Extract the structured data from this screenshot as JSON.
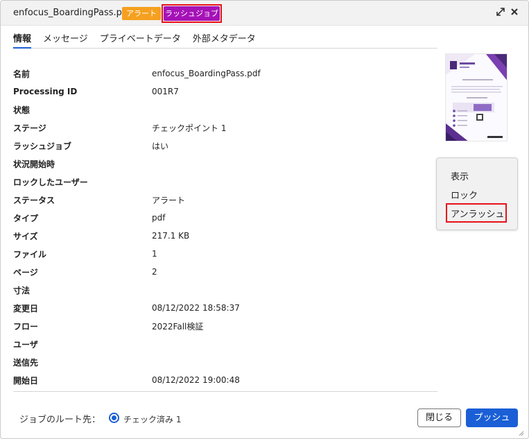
{
  "header": {
    "title": "enfocus_BoardingPass.pdf",
    "badge_alert": "アラート",
    "badge_rush": "ラッシュジョブ",
    "icons": [
      "expand-icon",
      "close-icon"
    ]
  },
  "tabs": [
    {
      "label": "情報",
      "active": true
    },
    {
      "label": "メッセージ",
      "active": false
    },
    {
      "label": "プライベートデータ",
      "active": false
    },
    {
      "label": "外部メタデータ",
      "active": false
    }
  ],
  "properties": [
    {
      "label": "名前",
      "value": "enfocus_BoardingPass.pdf"
    },
    {
      "label": "Processing ID",
      "value": "001R7"
    },
    {
      "label": "状態",
      "value": ""
    },
    {
      "label": "ステージ",
      "value": "チェックポイント 1"
    },
    {
      "label": "ラッシュジョブ",
      "value": "はい"
    },
    {
      "label": "状況開始時",
      "value": ""
    },
    {
      "label": "ロックしたユーザー",
      "value": ""
    },
    {
      "label": "ステータス",
      "value": "アラート"
    },
    {
      "label": "タイプ",
      "value": "pdf"
    },
    {
      "label": "サイズ",
      "value": "217.1 KB"
    },
    {
      "label": "ファイル",
      "value": "1"
    },
    {
      "label": "ページ",
      "value": "2"
    },
    {
      "label": "寸法",
      "value": ""
    },
    {
      "label": "変更日",
      "value": "08/12/2022 18:58:37"
    },
    {
      "label": "フロー",
      "value": "2022Fall検証"
    },
    {
      "label": "ユーザ",
      "value": ""
    },
    {
      "label": "送信先",
      "value": ""
    },
    {
      "label": "開始日",
      "value": "08/12/2022 19:00:48"
    }
  ],
  "menu": {
    "items": [
      "表示",
      "ロック",
      "アンラッシュ"
    ],
    "highlighted": "アンラッシュ"
  },
  "footer": {
    "route_label": "ジョブのルート先：",
    "route_option": "チェック済み 1",
    "close_button": "閉じる",
    "push_button": "プッシュ"
  },
  "colors": {
    "accent": "#1a5fd6",
    "alert_badge": "#f5a020",
    "rush_badge": "#a512b7",
    "highlight_border": "#e8111a"
  }
}
